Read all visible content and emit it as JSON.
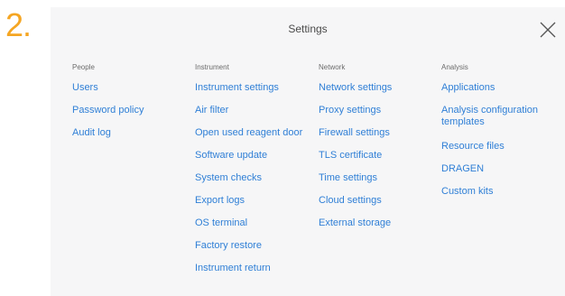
{
  "step": {
    "label": "2."
  },
  "panel": {
    "title": "Settings",
    "close_icon": "close-x-icon"
  },
  "columns": [
    {
      "header": "People",
      "items": [
        "Users",
        "Password policy",
        "Audit log"
      ]
    },
    {
      "header": "Instrument",
      "items": [
        "Instrument settings",
        "Air filter",
        "Open used reagent door",
        "Software update",
        "System checks",
        "Export logs",
        "OS terminal",
        "Factory restore",
        "Instrument return"
      ]
    },
    {
      "header": "Network",
      "items": [
        "Network settings",
        "Proxy settings",
        "Firewall settings",
        "TLS certificate",
        "Time settings",
        "Cloud settings",
        "External storage"
      ]
    },
    {
      "header": "Analysis",
      "items": [
        "Applications",
        "Analysis configuration templates",
        "Resource files",
        "DRAGEN",
        "Custom kits"
      ]
    }
  ],
  "colors": {
    "step_accent": "#f5a623",
    "link": "#2f7fd6",
    "panel_bg": "#f6f6f7",
    "header_text": "#6b6b6b"
  }
}
